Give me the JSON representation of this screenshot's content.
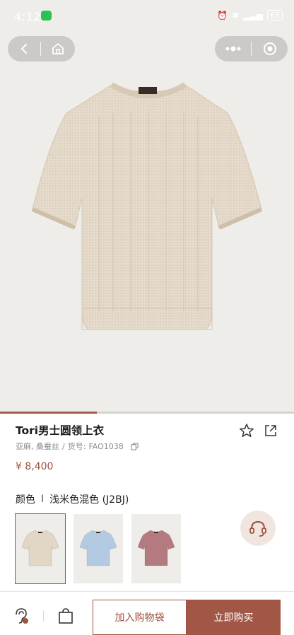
{
  "status_bar": {
    "time": "4:12",
    "battery": "65"
  },
  "product": {
    "title": "Tori男士圆领上衣",
    "material": "亚麻, 桑蚕丝",
    "sku_label": "货号:",
    "sku": "FAO1038",
    "price": "¥ 8,400",
    "color_label": "颜色",
    "color_separator": "I",
    "color_value": "浅米色混色 (J2BJ)"
  },
  "swatches": [
    {
      "name": "beige",
      "color": "#e2d6c4",
      "selected": true
    },
    {
      "name": "light-blue",
      "color": "#b4c9e2",
      "selected": false
    },
    {
      "name": "dusty-red",
      "color": "#b57a80",
      "selected": false
    }
  ],
  "image_progress": 0.33,
  "bottom_bar": {
    "add_to_cart": "加入购物袋",
    "buy_now": "立即购买"
  },
  "colors": {
    "accent": "#a0503e",
    "image_bg": "#efedea"
  }
}
